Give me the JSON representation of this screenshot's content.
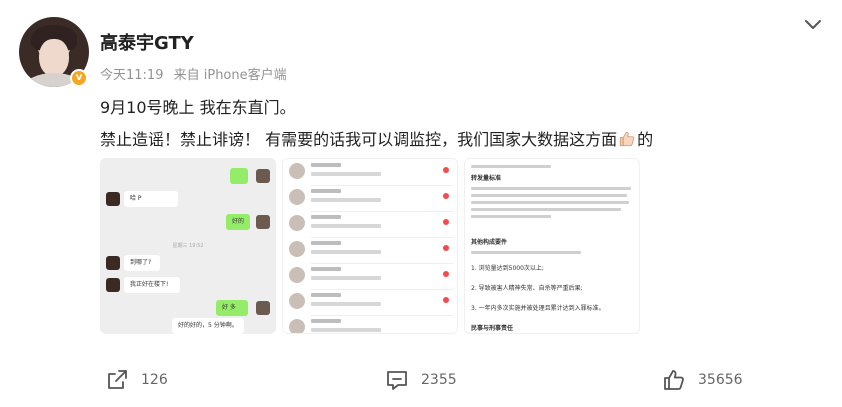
{
  "post": {
    "username": "高泰宇GTY",
    "time": "今天11:19",
    "source": "来自 iPhone客户端",
    "text_line1": "9月10号晚上 我在东直门。",
    "text_line2_a": "禁止造谣！禁止诽谤！ 有需要的话我可以调监控，我们国家大数据这方面",
    "text_line2_b": "的",
    "emoji": "thumbs-up-emoji"
  },
  "images": [
    {
      "name": "chat-screenshot"
    },
    {
      "name": "message-list-screenshot"
    },
    {
      "name": "legal-document-screenshot"
    }
  ],
  "chat": {
    "b1": "哈 P",
    "b2": "好的",
    "time": "星期三 19:52",
    "b3": "到哪了?",
    "b4": "我正好在楼下!",
    "b5": "好 多",
    "b6": "好的好的，5 分钟啊。"
  },
  "doc": {
    "h1": "转发量标准",
    "h2": "其他构成要件",
    "h3": "民事与刑事责任",
    "i1": "1. 浏览量达到5000次以上;",
    "i2": "2. 导致被害人精神失常、自杀等严重后果;",
    "i3": "3. 一年内多次实施并被处理且累计达到入罪标准。"
  },
  "actions": {
    "share_count": "126",
    "comment_count": "2355",
    "like_count": "35656"
  },
  "colors": {
    "text": "#222222",
    "meta": "#939393",
    "badge": "#f6a623",
    "chat_green": "#95ec69",
    "red_dot": "#f34b4b"
  }
}
